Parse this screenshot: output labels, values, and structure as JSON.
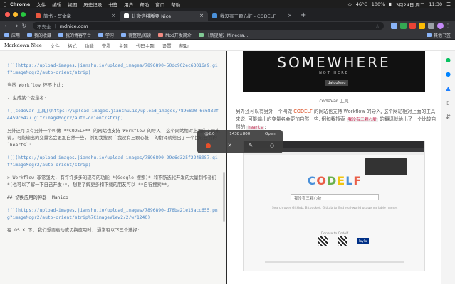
{
  "menubar": {
    "app": "Chrome",
    "items": [
      "文件",
      "编辑",
      "视图",
      "历史记录",
      "书签",
      "用户",
      "帮助",
      "窗口",
      "帮助"
    ],
    "status": {
      "battery": "46°C",
      "percent": "100%",
      "date": "3月24日 周二",
      "time": "11:30"
    }
  },
  "tabs": [
    {
      "title": "简书 - 写文章",
      "active": false,
      "color": "#e9573f"
    },
    {
      "title": "让微信排版变 Nice",
      "active": true,
      "color": "#3b3b3b"
    },
    {
      "title": "我没有三颗心脏 - CODELF",
      "active": false,
      "color": "#4a90d9"
    }
  ],
  "address": {
    "secure_label": "不安全",
    "url": "mdnice.com"
  },
  "bookmarks": {
    "items": [
      "应用",
      "我的收藏",
      "我的博客平台",
      "学习",
      "待整理/阅读",
      "Mod开发简介",
      "【新提醒】Minecra..."
    ],
    "other": "其他书签"
  },
  "appbar": {
    "brand": "Markdown Nice",
    "menus": [
      "文件",
      "格式",
      "功能",
      "查看",
      "主题",
      "代码主题",
      "设置",
      "帮助"
    ]
  },
  "editor": {
    "lines": [
      {
        "t": "![](https://upload-images.jianshu.io/upload_images/7896890-50dc902ec63016a9.gif?imageMogr2/auto-orient/strip)",
        "c": "link"
      },
      {
        "t": "",
        "c": "gap"
      },
      {
        "t": "当然 Workflow 还不止此:",
        "c": ""
      },
      {
        "t": "",
        "c": "gap"
      },
      {
        "t": "- 生成某个变量名:",
        "c": ""
      },
      {
        "t": "",
        "c": "gap"
      },
      {
        "t": "![[codeVar 工具](https://upload-images.jianshu.io/upload_images/7896890-6c6882f4459c6427.gif?imageMogr2/auto-orient/strip)",
        "c": "link"
      },
      {
        "t": "",
        "c": "gap"
      },
      {
        "t": "另外还可以有另外一个叫做 **CODELF** 的网站也支持 Workflow 的导入, 这个网站相对上面的工具来说, 可能输出的变量名会更加自然一些, 例如我搜索 `我没有三颗心脏` 的翻译就给出了一个比较自然的 `hearts`:",
        "c": ""
      },
      {
        "t": "",
        "c": "gap"
      },
      {
        "t": "![](https://upload-images.jianshu.io/upload_images/7896890-29c6d325f2248087.gif?imageMogr2/auto-orient/strip)",
        "c": "link"
      },
      {
        "t": "",
        "c": "gap"
      },
      {
        "t": "> Workflow 非常强大, 有许许多多的现有的功能 *(Google 搜索)* 和不断迭代开发的大量制作者们 *(也可以了解一下自己开发)*, 想要了解更多和下载的朋友可以 **自行搜索**。",
        "c": ""
      },
      {
        "t": "",
        "c": "gap"
      },
      {
        "t": "## 切换应用的神器: Manico",
        "c": "hdr"
      },
      {
        "t": "",
        "c": "gap"
      },
      {
        "t": "![](https://upload-images.jianshu.io/upload_images/7896890-d78ba21e15acc655.png?imageMogr2/auto-orient/strip%7CimageView2/2/w/1240)",
        "c": "link"
      },
      {
        "t": "",
        "c": "gap"
      },
      {
        "t": "在 OS X 下, 我们想要启动或切换应用时, 通常有以下三个选择:",
        "c": ""
      }
    ]
  },
  "preview": {
    "hero_big": "SOMEWHERE",
    "hero_small": "NOT HERE",
    "hero_tag": "datuofeng",
    "caption": "codeVar 工具",
    "para_before": "另外还可以有另外一个叫做 ",
    "para_bold": "CODELF",
    "para_mid": " 的网站也支持 Workflow 的导入, 这个网站相对上面的工具来说, 可能输出的变量名会更加自然一些, 例如我搜索 ",
    "para_code1": "我没有三颗心脏",
    "para_mid2": " 的翻译就给出了一个比较自然的 ",
    "para_code2": "hearts",
    "para_end": ":",
    "codelf_search": "我没有三颗心脏",
    "codelf_hint": "Search over GitHub, Bitbucket, GitLab to find real-world usage variable names",
    "codelf_donate": "Donate to Codelf",
    "codelf_paypal": "PayPal"
  },
  "shotbar": {
    "zoom": "@2.0",
    "size": "1438×800",
    "open": "Open"
  },
  "colors": {
    "accent_orange": "#d94a1e",
    "link_blue": "#4a86c5",
    "mac_red": "#ff5f57",
    "mac_yellow": "#febc2e",
    "mac_green": "#28c840"
  }
}
